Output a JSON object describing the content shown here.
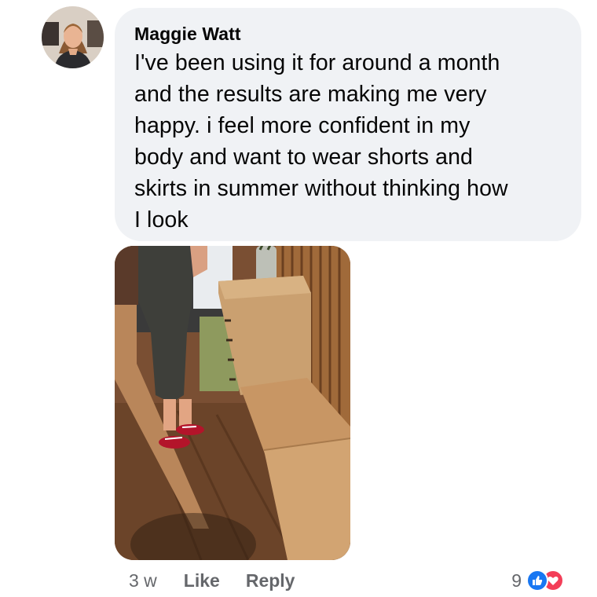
{
  "comment": {
    "author": "Maggie Watt",
    "text": "I've been using it for around a month\nand the results are making me very\nhappy. i feel more confident in my\nbody and want to wear shorts and\nskirts in summer without thinking how\nI look",
    "timestamp": "3 w",
    "like_label": "Like",
    "reply_label": "Reply",
    "reaction_count": "9",
    "reaction_icons": [
      "like-icon",
      "love-icon"
    ]
  },
  "colors": {
    "bubble_bg": "#f0f2f5",
    "meta_text": "#65676b",
    "like_blue": "#1877f2",
    "love_red": "#f33e58"
  }
}
